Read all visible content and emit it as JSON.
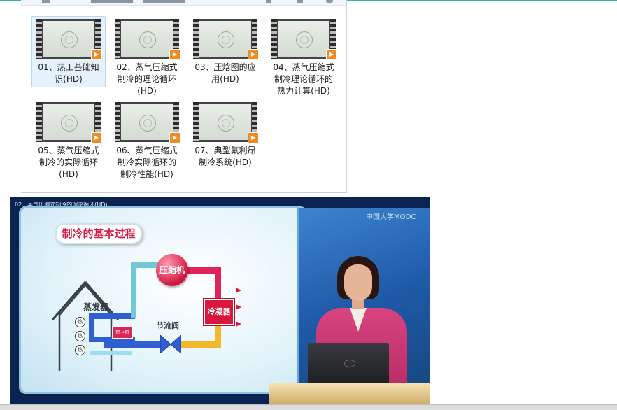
{
  "explorer": {
    "files": [
      {
        "name": "01、热工基础知识(HD)",
        "selected": true
      },
      {
        "name": "02、蒸气压缩式制冷的理论循环(HD)",
        "selected": false
      },
      {
        "name": "03、压焓图的应用(HD)",
        "selected": false
      },
      {
        "name": "04、蒸气压缩式制冷理论循环的热力计算(HD)",
        "selected": false
      },
      {
        "name": "05、蒸气压缩式制冷的实际循环(HD)",
        "selected": false
      },
      {
        "name": "06、蒸气压缩式制冷实际循环的制冷性能(HD)",
        "selected": false
      },
      {
        "name": "07、典型氟利昂制冷系统(HD)",
        "selected": false
      }
    ],
    "thumbnail_icon": "video-file-icon",
    "play_icon": "play-icon"
  },
  "video": {
    "title": "02、蒸气压缩式制冷的理论循环(HD)",
    "channel_logo": "中国大学MOOC",
    "slide": {
      "heading": "制冷的基本过程",
      "compressor": "压缩机",
      "condenser": "冷凝器",
      "evaporator": "蒸发器",
      "valve": "节流阀",
      "heat": "热",
      "heat_flow": "热→热"
    }
  },
  "colors": {
    "accent_top": "#3ab3a0",
    "selection": "#e5f1fb",
    "play_badge": "#f08a24",
    "pipe_hot": "#e0245a",
    "pipe_cold": "#2f5fd0",
    "pipe_warm": "#f2b82a"
  }
}
